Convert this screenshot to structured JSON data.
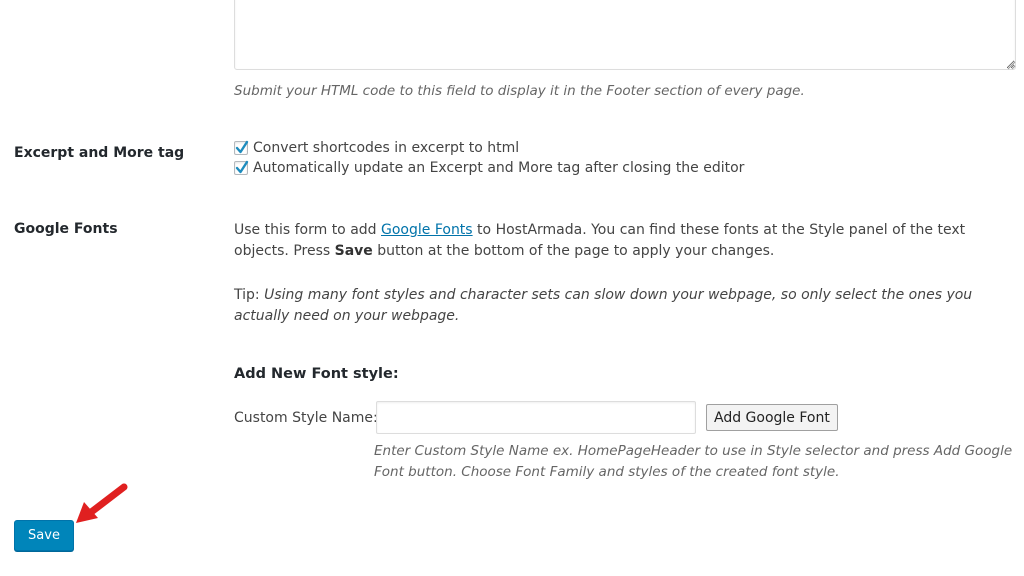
{
  "footer": {
    "textarea_value": "",
    "description": "Submit your HTML code to this field to display it in the Footer section of every page."
  },
  "excerpt": {
    "label": "Excerpt and More tag",
    "option1": "Convert shortcodes in excerpt to html",
    "option1_checked": true,
    "option2": "Automatically update an Excerpt and More tag after closing the editor",
    "option2_checked": true
  },
  "google_fonts": {
    "label": "Google Fonts",
    "intro_prefix": "Use this form to add ",
    "intro_link": "Google Fonts",
    "intro_mid": " to HostArmada. You can find these fonts at the Style panel of the text objects. Press ",
    "intro_bold": "Save",
    "intro_suffix": " button at the bottom of the page to apply your changes.",
    "tip_prefix": "Tip: ",
    "tip_text": "Using many font styles and character sets can slow down your webpage, so only select the ones you actually need on your webpage.",
    "add_heading": "Add New Font style:",
    "custom_style_label": "Custom Style Name:",
    "custom_style_value": "",
    "add_button": "Add Google Font",
    "custom_desc": "Enter Custom Style Name ex. HomePageHeader to use in Style selector and press Add Google Font button. Choose Font Family and styles of the created font style."
  },
  "save_button": "Save",
  "colors": {
    "accent": "#0085ba",
    "link": "#0073aa",
    "arrow": "#e02020"
  },
  "icons": {
    "check": "check-icon",
    "arrow": "red-arrow-icon",
    "grip": "resize-grip-icon"
  }
}
